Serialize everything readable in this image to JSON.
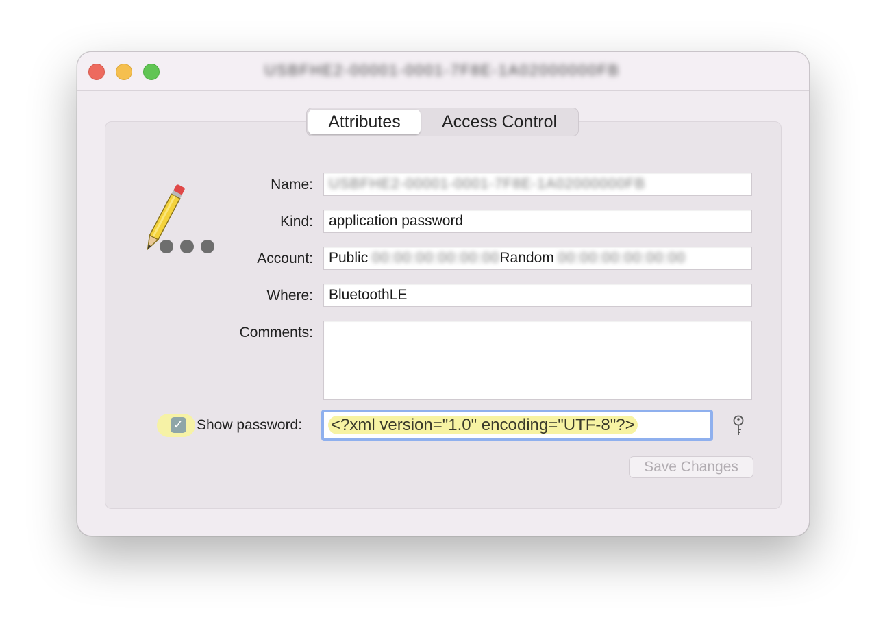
{
  "window": {
    "title": "USBFHE2-00001-0001-7F8E-1A02000000FB"
  },
  "tabs": [
    {
      "label": "Attributes",
      "selected": true
    },
    {
      "label": "Access Control",
      "selected": false
    }
  ],
  "form": {
    "name": {
      "label": "Name:",
      "value": "USBFHE2-00001-0001-7F8E-1A02000000FB"
    },
    "kind": {
      "label": "Kind:",
      "value": "application password"
    },
    "account": {
      "label": "Account:",
      "value_part1": "Public",
      "value_hidden1": "00:00:00:00:00:00",
      "value_part2": "Random",
      "value_hidden2": "00:00:00:00:00:00"
    },
    "where": {
      "label": "Where:",
      "value": "BluetoothLE"
    },
    "comments": {
      "label": "Comments:",
      "value": ""
    },
    "show_password": {
      "label": "Show password:",
      "checked": true
    },
    "password": {
      "value": "<?xml version=\"1.0\" encoding=\"UTF-8\"?>"
    },
    "save_button": {
      "label": "Save Changes",
      "enabled": false
    }
  },
  "icons": {
    "item_icon": "pencil-password-icon",
    "key": "key-icon"
  },
  "colors": {
    "close": "#ed6a5e",
    "minimize": "#f5bf4f",
    "zoom": "#61c554",
    "focus_ring": "#8fb0ee",
    "highlight": "#f6f2a6"
  }
}
